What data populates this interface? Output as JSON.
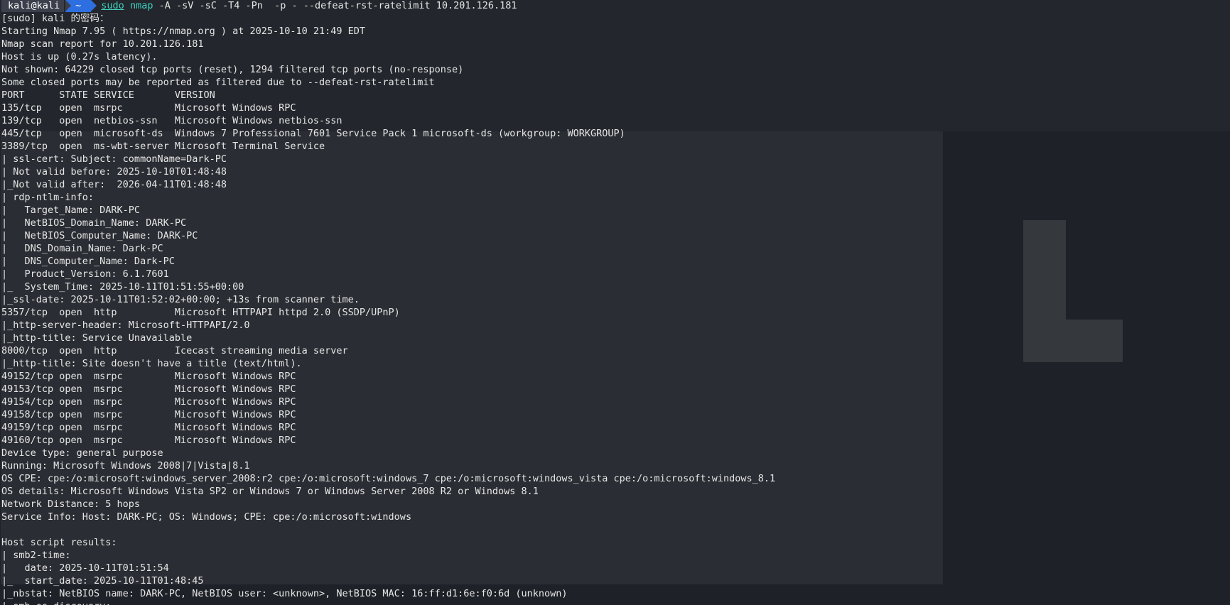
{
  "prompt": {
    "user": "kali@kali",
    "dir": "~",
    "sudo": "sudo",
    "bin": "nmap",
    "args": " -A -sV -sC -T4 -Pn  -p - --defeat-rst-ratelimit 10.201.126.181"
  },
  "output_lines": [
    "[sudo] kali 的密码：",
    "Starting Nmap 7.95 ( https://nmap.org ) at 2025-10-10 21:49 EDT",
    "Nmap scan report for 10.201.126.181",
    "Host is up (0.27s latency).",
    "Not shown: 64229 closed tcp ports (reset), 1294 filtered tcp ports (no-response)",
    "Some closed ports may be reported as filtered due to --defeat-rst-ratelimit",
    "PORT      STATE SERVICE       VERSION",
    "135/tcp   open  msrpc         Microsoft Windows RPC",
    "139/tcp   open  netbios-ssn   Microsoft Windows netbios-ssn",
    "445/tcp   open  microsoft-ds  Windows 7 Professional 7601 Service Pack 1 microsoft-ds (workgroup: WORKGROUP)",
    "3389/tcp  open  ms-wbt-server Microsoft Terminal Service",
    "| ssl-cert: Subject: commonName=Dark-PC",
    "| Not valid before: 2025-10-10T01:48:48",
    "|_Not valid after:  2026-04-11T01:48:48",
    "| rdp-ntlm-info:",
    "|   Target_Name: DARK-PC",
    "|   NetBIOS_Domain_Name: DARK-PC",
    "|   NetBIOS_Computer_Name: DARK-PC",
    "|   DNS_Domain_Name: Dark-PC",
    "|   DNS_Computer_Name: Dark-PC",
    "|   Product_Version: 6.1.7601",
    "|_  System_Time: 2025-10-11T01:51:55+00:00",
    "|_ssl-date: 2025-10-11T01:52:02+00:00; +13s from scanner time.",
    "5357/tcp  open  http          Microsoft HTTPAPI httpd 2.0 (SSDP/UPnP)",
    "|_http-server-header: Microsoft-HTTPAPI/2.0",
    "|_http-title: Service Unavailable",
    "8000/tcp  open  http          Icecast streaming media server",
    "|_http-title: Site doesn't have a title (text/html).",
    "49152/tcp open  msrpc         Microsoft Windows RPC",
    "49153/tcp open  msrpc         Microsoft Windows RPC",
    "49154/tcp open  msrpc         Microsoft Windows RPC",
    "49158/tcp open  msrpc         Microsoft Windows RPC",
    "49159/tcp open  msrpc         Microsoft Windows RPC",
    "49160/tcp open  msrpc         Microsoft Windows RPC",
    "Device type: general purpose",
    "Running: Microsoft Windows 2008|7|Vista|8.1",
    "OS CPE: cpe:/o:microsoft:windows_server_2008:r2 cpe:/o:microsoft:windows_7 cpe:/o:microsoft:windows_vista cpe:/o:microsoft:windows_8.1",
    "OS details: Microsoft Windows Vista SP2 or Windows 7 or Windows Server 2008 R2 or Windows 8.1",
    "Network Distance: 5 hops",
    "Service Info: Host: DARK-PC; OS: Windows; CPE: cpe:/o:microsoft:windows",
    "",
    "Host script results:",
    "| smb2-time:",
    "|   date: 2025-10-11T01:51:54",
    "|_  start_date: 2025-10-11T01:48:45",
    "|_nbstat: NetBIOS name: DARK-PC, NetBIOS user: <unknown>, NetBIOS MAC: 16:ff:d1:6e:f0:6d (unknown)",
    "| smb-os-discovery:"
  ]
}
